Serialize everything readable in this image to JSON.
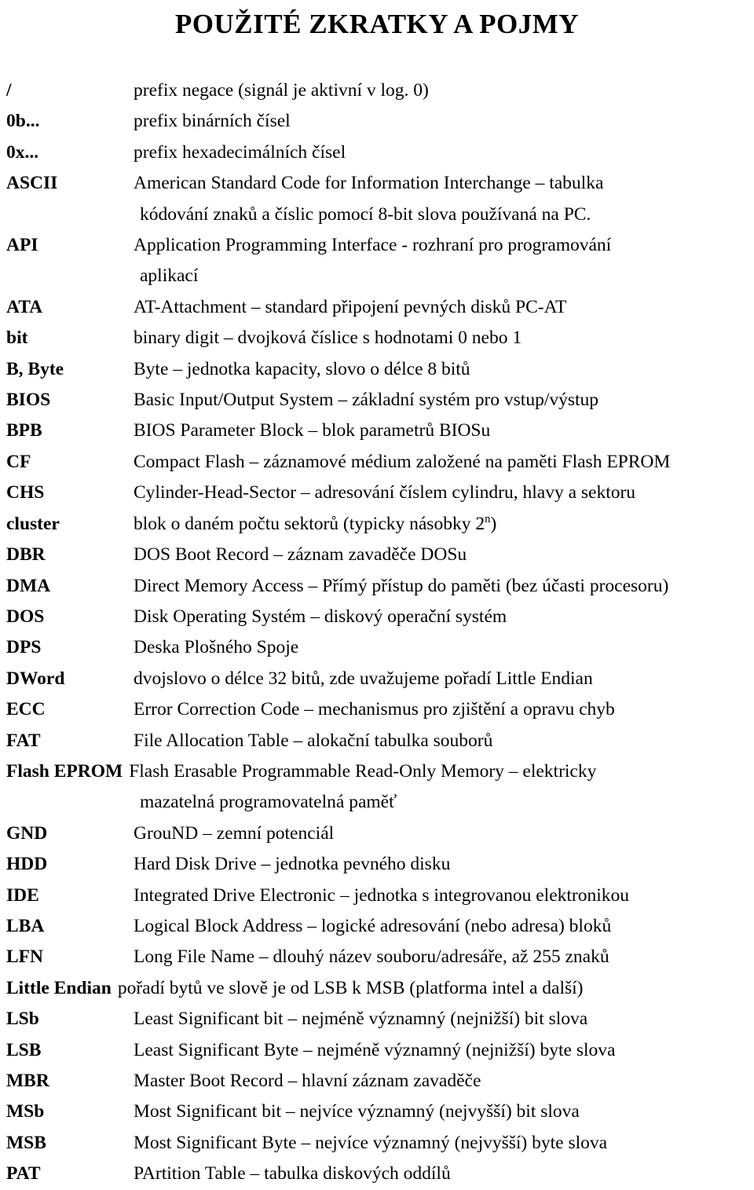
{
  "document": {
    "title": "POUŽITÉ ZKRATKY A POJMY"
  },
  "glossary": {
    "entries": [
      {
        "term": "/",
        "definition": "prefix negace (signál je aktivní v log. 0)"
      },
      {
        "term": "0b...",
        "definition": "prefix binárních čísel"
      },
      {
        "term": "0x...",
        "definition": "prefix hexadecimálních čísel"
      },
      {
        "term": "ASCII",
        "definition": "American Standard Code for Information Interchange – tabulka",
        "continuation": "kódování znaků a číslic pomocí 8-bit slova používaná na PC."
      },
      {
        "term": "API",
        "definition": "Application Programming Interface - rozhraní pro programování",
        "continuation": "aplikací"
      },
      {
        "term": "ATA",
        "definition": "AT-Attachment – standard připojení pevných disků PC-AT"
      },
      {
        "term": "bit",
        "definition": "binary digit – dvojková číslice s hodnotami 0 nebo 1"
      },
      {
        "term": "B, Byte",
        "definition": "Byte – jednotka kapacity, slovo o délce 8 bitů"
      },
      {
        "term": "BIOS",
        "definition": "Basic Input/Output System – základní systém pro vstup/výstup"
      },
      {
        "term": "BPB",
        "definition": "BIOS Parameter Block – blok parametrů BIOSu"
      },
      {
        "term": "CF",
        "definition": "Compact Flash – záznamové médium založené na paměti Flash EPROM"
      },
      {
        "term": "CHS",
        "definition": "Cylinder-Head-Sector – adresování číslem cylindru, hlavy a sektoru"
      },
      {
        "term": "cluster",
        "definition_pre": "blok o daném počtu sektorů (typicky násobky 2",
        "definition_sup": "n",
        "definition_post": ")"
      },
      {
        "term": "DBR",
        "definition": "DOS Boot Record – záznam zavaděče DOSu"
      },
      {
        "term": "DMA",
        "definition": "Direct Memory Access – Přímý přístup do paměti (bez účasti procesoru)"
      },
      {
        "term": "DOS",
        "definition": "Disk Operating Systém – diskový operační systém"
      },
      {
        "term": "DPS",
        "definition": "Deska Plošného Spoje"
      },
      {
        "term": "DWord",
        "definition": "dvojslovo o délce 32 bitů, zde uvažujeme pořadí Little Endian"
      },
      {
        "term": "ECC",
        "definition": "Error Correction Code – mechanismus pro zjištění a opravu chyb"
      },
      {
        "term": "FAT",
        "definition": "File Allocation Table – alokační tabulka souborů"
      },
      {
        "term": "Flash EPROM",
        "definition": "Flash Erasable Programmable Read-Only Memory – elektricky",
        "continuation": "mazatelná programovatelná paměť",
        "wide": true
      },
      {
        "term": "GND",
        "definition": "GrouND – zemní potenciál"
      },
      {
        "term": "HDD",
        "definition": "Hard Disk Drive – jednotka pevného disku"
      },
      {
        "term": "IDE",
        "definition": "Integrated Drive Electronic – jednotka s integrovanou elektronikou"
      },
      {
        "term": "LBA",
        "definition": "Logical Block Address – logické adresování (nebo adresa) bloků"
      },
      {
        "term": "LFN",
        "definition": "Long File Name – dlouhý název souboru/adresáře, až 255 znaků"
      },
      {
        "term": "Little Endian",
        "definition": "pořadí bytů ve slově je od LSB k MSB (platforma intel a další)",
        "wide": true
      },
      {
        "term": "LSb",
        "definition": "Least Significant bit – nejméně významný (nejnižší) bit slova"
      },
      {
        "term": "LSB",
        "definition": "Least Significant Byte – nejméně významný (nejnižší) byte slova"
      },
      {
        "term": "MBR",
        "definition": "Master Boot Record – hlavní záznam zavaděče"
      },
      {
        "term": "MSb",
        "definition": "Most Significant bit – nejvíce významný (nejvyšší) bit slova"
      },
      {
        "term": "MSB",
        "definition": "Most Significant Byte – nejvíce významný (nejvyšší) byte slova"
      },
      {
        "term": "PAT",
        "definition": "PArtition Table – tabulka diskových oddílů"
      }
    ]
  }
}
